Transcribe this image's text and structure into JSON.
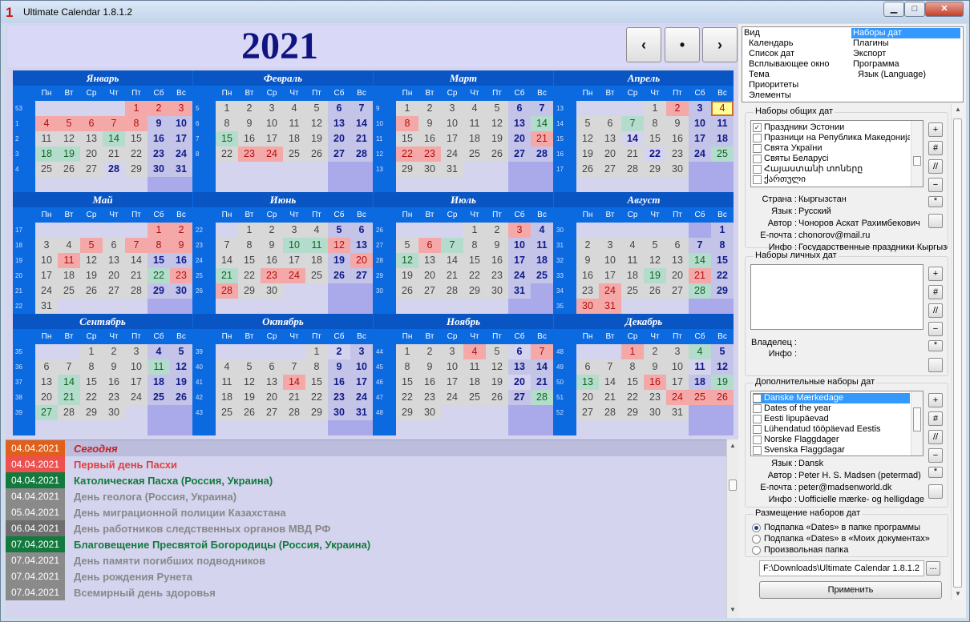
{
  "window": {
    "title": "Ultimate Calendar 1.8.1.2",
    "app_glyph": "1",
    "minimize": "▁",
    "maximize": "□",
    "close": "✕"
  },
  "year_view": {
    "year": "2021",
    "nav_prev": "‹",
    "nav_today": "•",
    "nav_next": "›"
  },
  "weekday_names": [
    "Пн",
    "Вт",
    "Ср",
    "Чт",
    "Пт",
    "Сб",
    "Вс"
  ],
  "months": [
    {
      "name": "Январь",
      "weeks": [
        "53",
        "1",
        "2",
        "3",
        "4"
      ],
      "first_dow": 4,
      "days": 31,
      "marks": {
        "1": "ho",
        "2": "ho",
        "3": "ho",
        "4": "ho",
        "5": "ho",
        "6": "ho",
        "7": "ho",
        "8": "ho",
        "14": "gr",
        "18": "gr",
        "19": "gr",
        "28": "bl"
      }
    },
    {
      "name": "Февраль",
      "weeks": [
        "5",
        "6",
        "7",
        "8"
      ],
      "first_dow": 0,
      "days": 28,
      "marks": {
        "15": "gr",
        "23": "ho",
        "24": "ho"
      }
    },
    {
      "name": "Март",
      "weeks": [
        "9",
        "10",
        "11",
        "12",
        "13"
      ],
      "first_dow": 0,
      "days": 31,
      "marks": {
        "8": "ho",
        "14": "gr",
        "21": "ho",
        "22": "ho",
        "23": "ho"
      }
    },
    {
      "name": "Апрель",
      "weeks": [
        "13",
        "14",
        "15",
        "16",
        "17"
      ],
      "first_dow": 3,
      "days": 30,
      "marks": {
        "2": "ho",
        "4": "td",
        "7": "gr",
        "14": "bl",
        "22": "bl",
        "25": "gr"
      }
    },
    {
      "name": "Май",
      "weeks": [
        "17",
        "18",
        "19",
        "20",
        "21",
        "22"
      ],
      "first_dow": 5,
      "days": 31,
      "marks": {
        "1": "ho",
        "2": "ho",
        "5": "ho",
        "7": "ho",
        "8": "ho",
        "9": "ho",
        "11": "ho",
        "22": "gr",
        "23": "ho"
      }
    },
    {
      "name": "Июнь",
      "weeks": [
        "22",
        "23",
        "24",
        "25",
        "26"
      ],
      "first_dow": 1,
      "days": 30,
      "marks": {
        "10": "gr",
        "11": "gr",
        "12": "ho",
        "20": "ho",
        "21": "gr",
        "23": "ho",
        "24": "ho",
        "28": "ho"
      }
    },
    {
      "name": "Июль",
      "weeks": [
        "26",
        "27",
        "28",
        "29",
        "30"
      ],
      "first_dow": 3,
      "days": 31,
      "marks": {
        "3": "ho",
        "6": "ho",
        "7": "gr",
        "12": "gr"
      }
    },
    {
      "name": "Август",
      "weeks": [
        "30",
        "31",
        "32",
        "33",
        "34",
        "35"
      ],
      "first_dow": 6,
      "days": 31,
      "marks": {
        "14": "gr",
        "19": "gr",
        "21": "ho",
        "24": "ho",
        "28": "gr",
        "30": "ho",
        "31": "ho"
      }
    },
    {
      "name": "Сентябрь",
      "weeks": [
        "35",
        "36",
        "37",
        "38",
        "39"
      ],
      "first_dow": 2,
      "days": 30,
      "marks": {
        "11": "gr",
        "14": "gr",
        "21": "gr",
        "27": "gr"
      }
    },
    {
      "name": "Октябрь",
      "weeks": [
        "39",
        "40",
        "41",
        "42",
        "43"
      ],
      "first_dow": 4,
      "days": 31,
      "marks": {
        "2": "bl",
        "14": "ho"
      }
    },
    {
      "name": "Ноябрь",
      "weeks": [
        "44",
        "45",
        "46",
        "47",
        "48"
      ],
      "first_dow": 0,
      "days": 30,
      "marks": {
        "4": "ho",
        "6": "bl",
        "7": "ho",
        "20": "bl",
        "28": "gr"
      }
    },
    {
      "name": "Декабрь",
      "weeks": [
        "48",
        "49",
        "50",
        "51",
        "52"
      ],
      "first_dow": 2,
      "days": 31,
      "marks": {
        "1": "ho",
        "4": "gr",
        "11": "bl",
        "13": "gr",
        "16": "ho",
        "19": "gr",
        "24": "ho",
        "25": "ho",
        "26": "ho"
      }
    }
  ],
  "events": [
    {
      "date": "04.04.2021",
      "name": "Сегодня",
      "date_bg": "#e0601a",
      "row_bg": "#bcbcdc",
      "color": "#c82020",
      "italic": true
    },
    {
      "date": "04.04.2021",
      "name": "Первый день Пасхи",
      "date_bg": "#ee5050",
      "row_bg": "#d4d4ee",
      "color": "#e04040",
      "italic": false
    },
    {
      "date": "04.04.2021",
      "name": "Католическая Пасха (Россия, Украина)",
      "date_bg": "#127a3c",
      "row_bg": "#d4d4ee",
      "color": "#127a3c",
      "italic": false
    },
    {
      "date": "04.04.2021",
      "name": "День геолога (Россия, Украина)",
      "date_bg": "#8a8a8a",
      "row_bg": "#d4d4ee",
      "color": "#888888",
      "italic": false
    },
    {
      "date": "05.04.2021",
      "name": "День миграционной полиции Казахстана",
      "date_bg": "#8a8a8a",
      "row_bg": "#d4d4ee",
      "color": "#888888",
      "italic": false
    },
    {
      "date": "06.04.2021",
      "name": "День работников следственных органов МВД РФ",
      "date_bg": "#6e6e6e",
      "row_bg": "#d4d4ee",
      "color": "#888888",
      "italic": false
    },
    {
      "date": "07.04.2021",
      "name": "Благовещение Пресвятой Богородицы (Россия, Украина)",
      "date_bg": "#127a3c",
      "row_bg": "#d4d4ee",
      "color": "#127a3c",
      "italic": false
    },
    {
      "date": "07.04.2021",
      "name": "День памяти погибших подводников",
      "date_bg": "#8a8a8a",
      "row_bg": "#d4d4ee",
      "color": "#888888",
      "italic": false
    },
    {
      "date": "07.04.2021",
      "name": "День рождения Рунета",
      "date_bg": "#8a8a8a",
      "row_bg": "#d4d4ee",
      "color": "#888888",
      "italic": false
    },
    {
      "date": "07.04.2021",
      "name": "Всемирный день здоровья",
      "date_bg": "#8a8a8a",
      "row_bg": "#d4d4ee",
      "color": "#888888",
      "italic": false
    }
  ],
  "settings_tree": {
    "col1": [
      "Вид",
      "Календарь",
      "Список дат",
      "Всплывающее окно",
      "Тема",
      "Приоритеты",
      "Элементы"
    ],
    "col2": [
      "Наборы дат",
      "Плагины",
      "Экспорт",
      "Программа",
      "Язык (Language)"
    ],
    "selected": "Наборы дат"
  },
  "common_sets": {
    "title": "Наборы общих дат",
    "items": [
      {
        "label": "Праздники Эстонии",
        "checked": true
      },
      {
        "label": "Празници на Република Македонија",
        "checked": false
      },
      {
        "label": "Свята України",
        "checked": false
      },
      {
        "label": "Святы Беларусі",
        "checked": false
      },
      {
        "label": "Հայաստանի տոները",
        "checked": false
      },
      {
        "label": "ქართული",
        "checked": false
      }
    ],
    "buttons": [
      "+",
      "#",
      "//",
      "−",
      "*",
      ""
    ],
    "info": [
      {
        "label": "Страна :",
        "value": "Кыргызстан"
      },
      {
        "label": "Язык :",
        "value": "Русский"
      },
      {
        "label": "Автор :",
        "value": "Чоноров Аскат Рахимбекович"
      },
      {
        "label": "E-почта :",
        "value": "chonorov@mail.ru"
      },
      {
        "label": "Инфо :",
        "value": "Государственные праздники Кыргызстана"
      }
    ]
  },
  "personal_sets": {
    "title": "Наборы личных дат",
    "buttons": [
      "+",
      "#",
      "//",
      "−",
      "*",
      ""
    ],
    "info": [
      {
        "label": "Владелец :",
        "value": ""
      },
      {
        "label": "Инфо :",
        "value": ""
      }
    ]
  },
  "extra_sets": {
    "title": "Дополнительные наборы дат",
    "items": [
      {
        "label": "Danske Mærkedage",
        "checked": false,
        "selected": true
      },
      {
        "label": "Dates of the year",
        "checked": false,
        "selected": false
      },
      {
        "label": "Eesti lipupäevad",
        "checked": false,
        "selected": false
      },
      {
        "label": "Lühendatud tööpäevad Eestis",
        "checked": false,
        "selected": false
      },
      {
        "label": "Norske Flaggdager",
        "checked": false,
        "selected": false
      },
      {
        "label": "Svenska Flaggdagar",
        "checked": false,
        "selected": false
      }
    ],
    "buttons": [
      "+",
      "#",
      "//",
      "−",
      "*",
      ""
    ],
    "info": [
      {
        "label": "Язык :",
        "value": "Dansk"
      },
      {
        "label": "Автор :",
        "value": "Peter H. S. Madsen (petermad)"
      },
      {
        "label": "E-почта :",
        "value": "peter@madsenworld.dk"
      },
      {
        "label": "Инфо :",
        "value": "Uofficielle mærke- og helligdage"
      }
    ]
  },
  "placement": {
    "title": "Размещение наборов дат",
    "options": [
      "Подпапка «Dates» в папке программы",
      "Подпапка «Dates» в «Моих документах»",
      "Произвольная папка"
    ],
    "selected_index": 0
  },
  "path_field": {
    "value": "F:\\Downloads\\Ultimate Calendar 1.8.1.2 F",
    "browse_label": "..."
  },
  "apply_label": "Применить"
}
